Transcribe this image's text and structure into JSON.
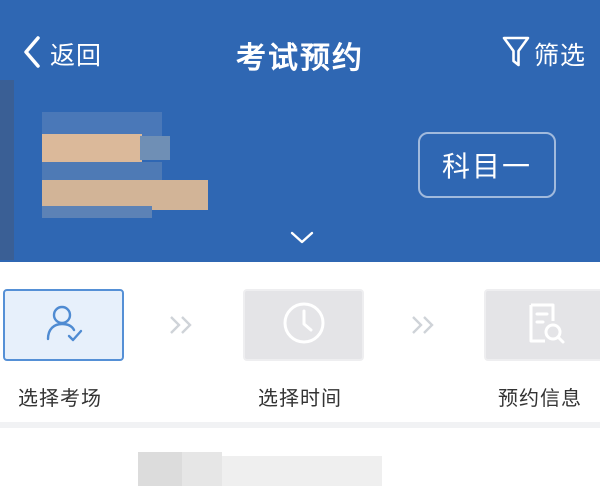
{
  "topbar": {
    "back_label": "返回",
    "title": "考试预约",
    "filter_label": "筛选"
  },
  "subject_button": {
    "label": "科目一"
  },
  "steps": [
    {
      "label": "选择考场",
      "icon": "person-check-icon",
      "state": "active"
    },
    {
      "label": "选择时间",
      "icon": "clock-icon",
      "state": "inactive"
    },
    {
      "label": "预约信息",
      "icon": "document-search-icon",
      "state": "inactive"
    }
  ],
  "colors": {
    "header_bg": "#2f67b3",
    "active_border": "#5590d6",
    "active_bg": "#e7f0fb",
    "inactive_bg": "#e4e4e7"
  }
}
